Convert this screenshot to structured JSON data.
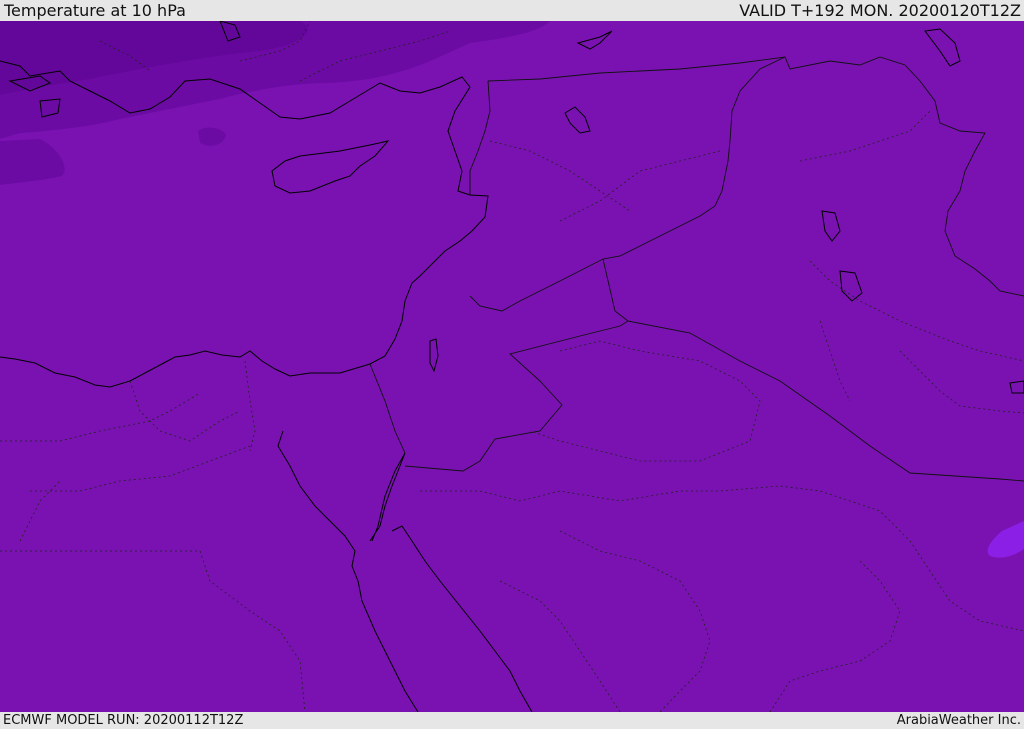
{
  "header": {
    "title": "Temperature at 10 hPa",
    "valid_time": "VALID T+192 MON. 20200120T12Z"
  },
  "footer": {
    "model_run": "ECMWF MODEL RUN: 20200112T12Z",
    "credit": "ArabiaWeather Inc."
  },
  "map": {
    "colors": {
      "field": "#7a12b2",
      "cold_region": "#6c0ba3",
      "colder_region": "#63079a",
      "warm_spot": "#8c1fe6",
      "coastline": "#000000",
      "border": "#111111"
    }
  }
}
